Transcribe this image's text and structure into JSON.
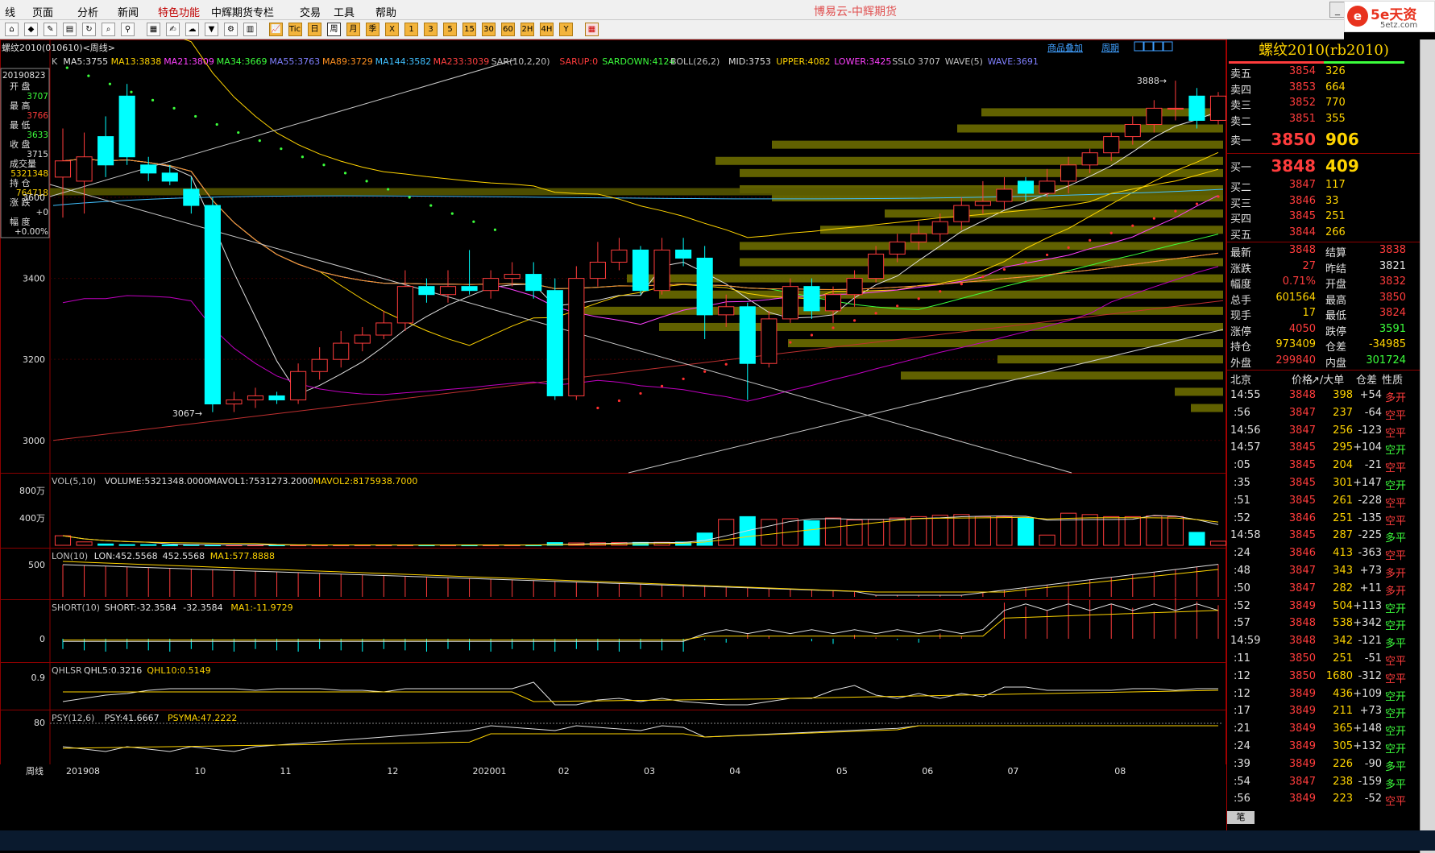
{
  "menu": [
    "线",
    "页面",
    "分析",
    "新闻",
    "特色功能",
    "中辉期货专栏",
    "交易",
    "工具",
    "帮助"
  ],
  "app_title": "博易云-中辉期货",
  "brand": {
    "name": "5e天资",
    "url": "5etz.com"
  },
  "toolbar": {
    "buttons": [
      "⌂",
      "◆",
      "✎",
      "▤",
      "↻",
      "⌕",
      "⚲",
      "▦",
      "✍",
      "☁",
      "▼",
      "⚙",
      "▥",
      "📈",
      "Tick",
      "日",
      "周",
      "月",
      "季",
      "X",
      "1",
      "3",
      "5",
      "15",
      "30",
      "60",
      "2H",
      "4H",
      "Y",
      "▦"
    ],
    "active": "周"
  },
  "contract": {
    "label": "螺纹2010(010610)<周线>",
    "tabs": [
      "商品叠加",
      "周期"
    ]
  },
  "indicators": {
    "ma_line": [
      {
        "t": "K",
        "c": "#c0c0c0"
      },
      {
        "t": "MA5:3755",
        "c": "#e0e0e0"
      },
      {
        "t": "MA13:3838",
        "c": "#ffd400"
      },
      {
        "t": "MA21:3809",
        "c": "#ff40ff"
      },
      {
        "t": "MA34:3669",
        "c": "#3cff3c"
      },
      {
        "t": "MA55:3763",
        "c": "#8080ff"
      },
      {
        "t": "MA89:3729",
        "c": "#ff9020"
      },
      {
        "t": "MA144:3582",
        "c": "#40c0ff"
      },
      {
        "t": "MA233:3039",
        "c": "#ff4040"
      },
      {
        "t": "SAR(10,2,20)",
        "c": "#c0c0c0"
      },
      {
        "t": "SARUP:0",
        "c": "#ff3c3c"
      },
      {
        "t": "SARDOWN:4124",
        "c": "#3cff3c"
      },
      {
        "t": "BOLL(26,2)",
        "c": "#c0c0c0"
      },
      {
        "t": "MID:3753",
        "c": "#e0e0e0"
      },
      {
        "t": "UPPER:4082",
        "c": "#ffd400"
      },
      {
        "t": "LOWER:3425",
        "c": "#ff40ff"
      },
      {
        "t": "SSLO 3707",
        "c": "#c0c0c0"
      },
      {
        "t": "WAVE(5)",
        "c": "#c0c0c0"
      },
      {
        "t": "WAVE:3691",
        "c": "#8080ff"
      }
    ],
    "vol_line": [
      {
        "t": "VOL(5,10)",
        "c": "#c0c0c0"
      },
      {
        "t": "VOLUME:5321348.0000",
        "c": "#e0e0e0"
      },
      {
        "t": "MAVOL1:7531273.2000",
        "c": "#e0e0e0"
      },
      {
        "t": "MAVOL2:8175938.7000",
        "c": "#ffd400"
      }
    ],
    "lon_line": [
      {
        "t": "LON(10)",
        "c": "#c0c0c0"
      },
      {
        "t": "LON:452.5568",
        "c": "#e0e0e0"
      },
      {
        "t": "452.5568",
        "c": "#e0e0e0"
      },
      {
        "t": "MA1:577.8888",
        "c": "#ffd400"
      }
    ],
    "short_line": [
      {
        "t": "SHORT(10)",
        "c": "#c0c0c0"
      },
      {
        "t": "SHORT:-32.3584",
        "c": "#e0e0e0"
      },
      {
        "t": "-32.3584",
        "c": "#e0e0e0"
      },
      {
        "t": "MA1:-11.9729",
        "c": "#ffd400"
      }
    ],
    "qhlsr_line": [
      {
        "t": "QHLSR",
        "c": "#c0c0c0"
      },
      {
        "t": "QHL5:0.3216",
        "c": "#e0e0e0"
      },
      {
        "t": "QHL10:0.5149",
        "c": "#ffd400"
      }
    ],
    "psy_line": [
      {
        "t": "PSY(12,6)",
        "c": "#c0c0c0"
      },
      {
        "t": "PSY:41.6667",
        "c": "#e0e0e0"
      },
      {
        "t": "PSYMA:47.2222",
        "c": "#ffd400"
      }
    ]
  },
  "info_box": {
    "date": "20190823",
    "open_label": "开 盘",
    "open": "3707",
    "high_label": "最 高",
    "high": "3766",
    "low_label": "最 低",
    "low": "3633",
    "close_label": "收 盘",
    "close": "3715",
    "vol_label": "成交量",
    "vol": "5321348",
    "oi_label": "持 仓",
    "oi": "764718",
    "chg_label": "涨 跌",
    "chg": "+0",
    "pct_label": "幅 度",
    "pct": "+0.00%"
  },
  "price_axis": [
    "3600",
    "3400",
    "3200",
    "3000"
  ],
  "vol_axis": [
    "800万",
    "400万"
  ],
  "lon_axis": "500",
  "short_axis": "0",
  "qhlsr_axis": "0.9",
  "psy_axis": "80",
  "time_axis": {
    "label": "周线",
    "ticks": [
      "201908",
      "10",
      "11",
      "12",
      "202001",
      "02",
      "03",
      "04",
      "05",
      "06",
      "07",
      "08"
    ]
  },
  "annotations": {
    "high": "3888→",
    "low": "3067→"
  },
  "chart_data": {
    "type": "candlestick",
    "title": "螺纹2010(010610)<周线>",
    "period": "周线",
    "ylim": [
      2920,
      3950
    ],
    "candles": [
      [
        3650,
        3690,
        3770,
        3550
      ],
      [
        3640,
        3700,
        3760,
        3560
      ],
      [
        3750,
        3680,
        3800,
        3650
      ],
      [
        3850,
        3700,
        3880,
        3680
      ],
      [
        3680,
        3660,
        3700,
        3640
      ],
      [
        3660,
        3640,
        3680,
        3630
      ],
      [
        3620,
        3580,
        3650,
        3560
      ],
      [
        3580,
        3090,
        3600,
        3070
      ],
      [
        3090,
        3100,
        3120,
        3070
      ],
      [
        3100,
        3110,
        3130,
        3080
      ],
      [
        3110,
        3100,
        3120,
        3090
      ],
      [
        3100,
        3170,
        3190,
        3090
      ],
      [
        3170,
        3200,
        3230,
        3150
      ],
      [
        3200,
        3240,
        3270,
        3180
      ],
      [
        3240,
        3260,
        3280,
        3220
      ],
      [
        3260,
        3290,
        3320,
        3250
      ],
      [
        3290,
        3380,
        3420,
        3270
      ],
      [
        3380,
        3360,
        3400,
        3340
      ],
      [
        3360,
        3380,
        3420,
        3340
      ],
      [
        3380,
        3370,
        3470,
        3360
      ],
      [
        3370,
        3400,
        3420,
        3350
      ],
      [
        3400,
        3410,
        3440,
        3380
      ],
      [
        3410,
        3370,
        3440,
        3350
      ],
      [
        3370,
        3110,
        3400,
        3100
      ],
      [
        3110,
        3400,
        3430,
        3100
      ],
      [
        3400,
        3440,
        3490,
        3380
      ],
      [
        3440,
        3470,
        3500,
        3420
      ],
      [
        3470,
        3370,
        3480,
        3360
      ],
      [
        3370,
        3470,
        3500,
        3360
      ],
      [
        3470,
        3450,
        3500,
        3430
      ],
      [
        3450,
        3310,
        3480,
        3250
      ],
      [
        3310,
        3330,
        3360,
        3280
      ],
      [
        3330,
        3190,
        3340,
        3100
      ],
      [
        3190,
        3300,
        3320,
        3180
      ],
      [
        3300,
        3380,
        3400,
        3290
      ],
      [
        3380,
        3320,
        3400,
        3300
      ],
      [
        3320,
        3360,
        3380,
        3290
      ],
      [
        3360,
        3400,
        3420,
        3330
      ],
      [
        3400,
        3460,
        3480,
        3390
      ],
      [
        3460,
        3490,
        3510,
        3440
      ],
      [
        3490,
        3510,
        3540,
        3470
      ],
      [
        3510,
        3540,
        3560,
        3490
      ],
      [
        3540,
        3580,
        3600,
        3520
      ],
      [
        3580,
        3590,
        3640,
        3560
      ],
      [
        3590,
        3620,
        3650,
        3570
      ],
      [
        3640,
        3610,
        3650,
        3590
      ],
      [
        3610,
        3640,
        3670,
        3600
      ],
      [
        3640,
        3680,
        3700,
        3610
      ],
      [
        3680,
        3710,
        3720,
        3660
      ],
      [
        3710,
        3750,
        3760,
        3690
      ],
      [
        3750,
        3780,
        3800,
        3730
      ],
      [
        3780,
        3820,
        3840,
        3760
      ],
      [
        3820,
        3820,
        3888,
        3790
      ],
      [
        3850,
        3790,
        3870,
        3770
      ],
      [
        3790,
        3850,
        3860,
        3780
      ]
    ],
    "volume_wan": [
      140,
      50,
      20,
      10,
      10,
      5,
      8,
      5,
      5,
      5,
      5,
      5,
      5,
      5,
      5,
      5,
      5,
      5,
      5,
      5,
      5,
      5,
      5,
      40,
      35,
      38,
      40,
      43,
      45,
      48,
      180,
      380,
      420,
      380,
      390,
      360,
      400,
      370,
      380,
      400,
      420,
      440,
      450,
      420,
      420,
      400,
      150,
      470,
      450,
      420,
      420,
      430,
      420,
      190,
      60
    ],
    "annotations": {
      "high": "3888",
      "low": "3067"
    }
  },
  "quote": {
    "title": "螺纹2010(rb2010)",
    "asks": [
      {
        "label": "卖五",
        "price": "3854",
        "vol": "326"
      },
      {
        "label": "卖四",
        "price": "3853",
        "vol": "664"
      },
      {
        "label": "卖三",
        "price": "3852",
        "vol": "770"
      },
      {
        "label": "卖二",
        "price": "3851",
        "vol": "355"
      },
      {
        "label": "卖一",
        "price": "3850",
        "vol": "906"
      }
    ],
    "bids": [
      {
        "label": "买一",
        "price": "3848",
        "vol": "409"
      },
      {
        "label": "买二",
        "price": "3847",
        "vol": "117"
      },
      {
        "label": "买三",
        "price": "3846",
        "vol": "33"
      },
      {
        "label": "买四",
        "price": "3845",
        "vol": "251"
      },
      {
        "label": "买五",
        "price": "3844",
        "vol": "266"
      }
    ],
    "stats": [
      {
        "l1": "最新",
        "v1": "3848",
        "c1": "r",
        "l2": "结算",
        "v2": "3838",
        "c2": "r"
      },
      {
        "l1": "涨跌",
        "v1": "27",
        "c1": "r",
        "l2": "昨结",
        "v2": "3821",
        "c2": "w"
      },
      {
        "l1": "幅度",
        "v1": "0.71%",
        "c1": "r",
        "l2": "开盘",
        "v2": "3832",
        "c2": "r"
      },
      {
        "l1": "总手",
        "v1": "601564",
        "c1": "y",
        "l2": "最高",
        "v2": "3850",
        "c2": "r"
      },
      {
        "l1": "现手",
        "v1": "17",
        "c1": "y",
        "l2": "最低",
        "v2": "3824",
        "c2": "r"
      },
      {
        "l1": "涨停",
        "v1": "4050",
        "c1": "r",
        "l2": "跌停",
        "v2": "3591",
        "c2": "g"
      },
      {
        "l1": "持仓",
        "v1": "973409",
        "c1": "y",
        "l2": "仓差",
        "v2": "-34985",
        "c2": "y"
      },
      {
        "l1": "外盘",
        "v1": "299840",
        "c1": "r",
        "l2": "内盘",
        "v2": "301724",
        "c2": "g"
      }
    ],
    "tick_header": [
      "北京",
      "价格",
      "↗/大单",
      "仓差",
      "性质"
    ],
    "ticks": [
      {
        "t": "14:55",
        "p": "3848",
        "v": "398",
        "d": "+54",
        "k": "多开",
        "pc": "r",
        "kc": "r"
      },
      {
        "t": ":56",
        "p": "3847",
        "v": "237",
        "d": "-64",
        "k": "空平",
        "pc": "r",
        "kc": "r"
      },
      {
        "t": "14:56",
        "p": "3847",
        "v": "256",
        "d": "-123",
        "k": "空平",
        "pc": "r",
        "kc": "r"
      },
      {
        "t": "14:57",
        "p": "3845",
        "v": "295",
        "d": "+104",
        "k": "空开",
        "pc": "r",
        "kc": "g"
      },
      {
        "t": ":05",
        "p": "3845",
        "v": "204",
        "d": "-21",
        "k": "空平",
        "pc": "r",
        "kc": "r"
      },
      {
        "t": ":35",
        "p": "3845",
        "v": "301",
        "d": "+147",
        "k": "空开",
        "pc": "r",
        "kc": "g"
      },
      {
        "t": ":51",
        "p": "3845",
        "v": "261",
        "d": "-228",
        "k": "空平",
        "pc": "r",
        "kc": "r"
      },
      {
        "t": ":52",
        "p": "3846",
        "v": "251",
        "d": "-135",
        "k": "空平",
        "pc": "r",
        "kc": "r"
      },
      {
        "t": "14:58",
        "p": "3845",
        "v": "287",
        "d": "-225",
        "k": "多平",
        "pc": "r",
        "kc": "g"
      },
      {
        "t": ":24",
        "p": "3846",
        "v": "413",
        "d": "-363",
        "k": "空平",
        "pc": "r",
        "kc": "r"
      },
      {
        "t": ":48",
        "p": "3847",
        "v": "343",
        "d": "+73",
        "k": "多开",
        "pc": "r",
        "kc": "r"
      },
      {
        "t": ":50",
        "p": "3847",
        "v": "282",
        "d": "+11",
        "k": "多开",
        "pc": "r",
        "kc": "r"
      },
      {
        "t": ":52",
        "p": "3849",
        "v": "504",
        "d": "+113",
        "k": "空开",
        "pc": "r",
        "kc": "g"
      },
      {
        "t": ":57",
        "p": "3848",
        "v": "538",
        "d": "+342",
        "k": "空开",
        "pc": "r",
        "kc": "g"
      },
      {
        "t": "14:59",
        "p": "3848",
        "v": "342",
        "d": "-121",
        "k": "多平",
        "pc": "r",
        "kc": "g"
      },
      {
        "t": ":11",
        "p": "3850",
        "v": "251",
        "d": "-51",
        "k": "空平",
        "pc": "r",
        "kc": "r"
      },
      {
        "t": ":12",
        "p": "3850",
        "v": "1680",
        "d": "-312",
        "k": "空平",
        "pc": "r",
        "kc": "r"
      },
      {
        "t": ":12",
        "p": "3849",
        "v": "436",
        "d": "+109",
        "k": "空开",
        "pc": "r",
        "kc": "g"
      },
      {
        "t": ":17",
        "p": "3849",
        "v": "211",
        "d": "+73",
        "k": "空开",
        "pc": "r",
        "kc": "g"
      },
      {
        "t": ":21",
        "p": "3849",
        "v": "365",
        "d": "+148",
        "k": "空开",
        "pc": "r",
        "kc": "g"
      },
      {
        "t": ":24",
        "p": "3849",
        "v": "305",
        "d": "+132",
        "k": "空开",
        "pc": "r",
        "kc": "g"
      },
      {
        "t": ":39",
        "p": "3849",
        "v": "226",
        "d": "-90",
        "k": "多平",
        "pc": "r",
        "kc": "g"
      },
      {
        "t": ":54",
        "p": "3847",
        "v": "238",
        "d": "-159",
        "k": "多平",
        "pc": "r",
        "kc": "g"
      },
      {
        "t": ":56",
        "p": "3849",
        "v": "223",
        "d": "-52",
        "k": "空平",
        "pc": "r",
        "kc": "r"
      }
    ],
    "footer": "笔"
  },
  "colors": {
    "up": "#ff3c3c",
    "down": "#00ffff",
    "bg": "#000000",
    "grid": "#8b0000"
  }
}
